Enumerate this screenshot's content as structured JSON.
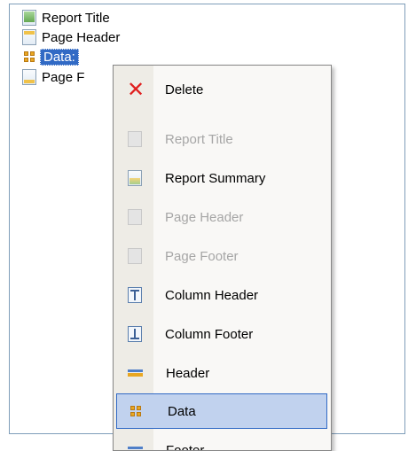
{
  "tree": {
    "items": [
      {
        "label": "Report Title",
        "icon": "report-title-band-icon"
      },
      {
        "label": "Page Header",
        "icon": "page-header-band-icon"
      },
      {
        "label": "Data:",
        "icon": "data-band-icon",
        "selected": true
      },
      {
        "label": "Page F",
        "icon": "page-footer-band-icon"
      }
    ]
  },
  "context_menu": {
    "items": [
      {
        "label": "Delete",
        "icon": "delete-icon",
        "enabled": true
      },
      {
        "label": "Report Title",
        "icon": "report-title-icon",
        "enabled": false
      },
      {
        "label": "Report Summary",
        "icon": "report-summary-icon",
        "enabled": true
      },
      {
        "label": "Page Header",
        "icon": "page-header-icon",
        "enabled": false
      },
      {
        "label": "Page Footer",
        "icon": "page-footer-icon",
        "enabled": false
      },
      {
        "label": "Column Header",
        "icon": "column-header-icon",
        "enabled": true
      },
      {
        "label": "Column Footer",
        "icon": "column-footer-icon",
        "enabled": true
      },
      {
        "label": "Header",
        "icon": "header-band-icon",
        "enabled": true
      },
      {
        "label": "Data",
        "icon": "data-band-icon",
        "enabled": true,
        "highlighted": true
      },
      {
        "label": "Footer",
        "icon": "footer-band-icon",
        "enabled": true
      }
    ]
  },
  "colors": {
    "selection": "#316ac5",
    "menu_highlight": "#c1d2ee",
    "menu_background": "#f9f8f6",
    "gutter": "#eeece6",
    "delete_icon": "#e02020",
    "disabled_text": "#a6a6a6"
  }
}
